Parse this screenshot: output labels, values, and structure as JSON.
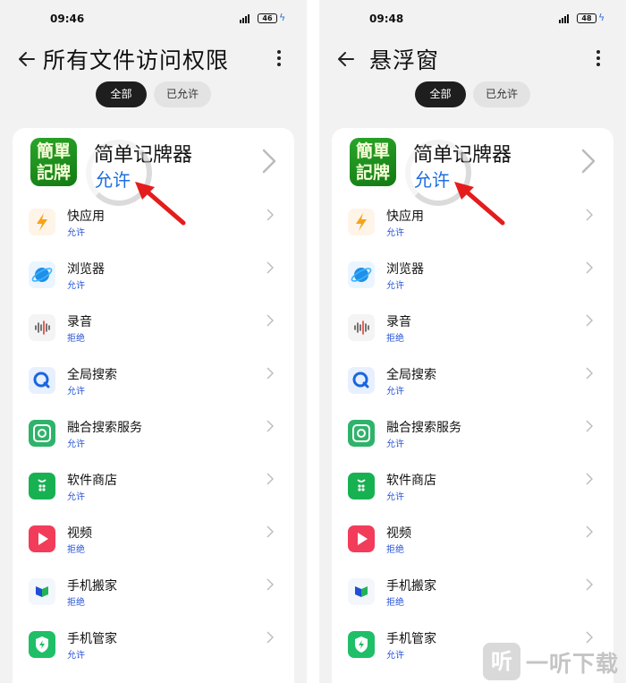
{
  "screens": [
    {
      "time": "09:46",
      "battery": "46",
      "title": "所有文件访问权限",
      "tabs": [
        "全部",
        "已允许"
      ],
      "featured": {
        "name": "简单记牌器",
        "icon_text": "簡單\n記牌",
        "status": "允许"
      },
      "apps": [
        {
          "name": "快应用",
          "status": "允许",
          "icon": "quick-app-icon"
        },
        {
          "name": "浏览器",
          "status": "允许",
          "icon": "browser-icon"
        },
        {
          "name": "录音",
          "status": "拒绝",
          "icon": "recorder-icon"
        },
        {
          "name": "全局搜索",
          "status": "允许",
          "icon": "global-search-icon"
        },
        {
          "name": "融合搜索服务",
          "status": "允许",
          "icon": "fusion-search-icon"
        },
        {
          "name": "软件商店",
          "status": "允许",
          "icon": "app-store-icon"
        },
        {
          "name": "视频",
          "status": "拒绝",
          "icon": "video-icon"
        },
        {
          "name": "手机搬家",
          "status": "拒绝",
          "icon": "phone-clone-icon"
        },
        {
          "name": "手机管家",
          "status": "允许",
          "icon": "phone-manager-icon"
        }
      ]
    },
    {
      "time": "09:48",
      "battery": "48",
      "title": "悬浮窗",
      "tabs": [
        "全部",
        "已允许"
      ],
      "featured": {
        "name": "简单记牌器",
        "icon_text": "簡單\n記牌",
        "status": "允许"
      },
      "apps": [
        {
          "name": "快应用",
          "status": "允许",
          "icon": "quick-app-icon"
        },
        {
          "name": "浏览器",
          "status": "允许",
          "icon": "browser-icon"
        },
        {
          "name": "录音",
          "status": "拒绝",
          "icon": "recorder-icon"
        },
        {
          "name": "全局搜索",
          "status": "允许",
          "icon": "global-search-icon"
        },
        {
          "name": "融合搜索服务",
          "status": "允许",
          "icon": "fusion-search-icon"
        },
        {
          "name": "软件商店",
          "status": "允许",
          "icon": "app-store-icon"
        },
        {
          "name": "视频",
          "status": "拒绝",
          "icon": "video-icon"
        },
        {
          "name": "手机搬家",
          "status": "拒绝",
          "icon": "phone-clone-icon"
        },
        {
          "name": "手机管家",
          "status": "允许",
          "icon": "phone-manager-icon"
        }
      ]
    }
  ],
  "watermark": {
    "logo": "听",
    "text": "一听下载"
  },
  "colors": {
    "accent": "#1e6fe0",
    "status_small": "#2a55d8",
    "arrow": "#e51c1c"
  }
}
